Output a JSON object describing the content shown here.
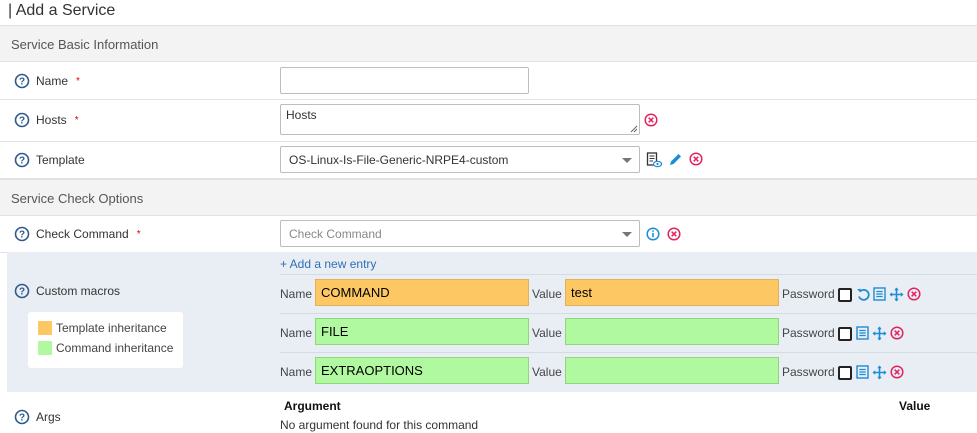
{
  "page": {
    "title": "| Add a Service"
  },
  "sections": {
    "basic": "Service Basic Information",
    "check": "Service Check Options"
  },
  "fields": {
    "name": {
      "label": "Name",
      "required": "*",
      "value": ""
    },
    "hosts": {
      "label": "Hosts",
      "required": "*",
      "value": "Hosts"
    },
    "template": {
      "label": "Template",
      "value": "OS-Linux-Is-File-Generic-NRPE4-custom"
    },
    "check_command": {
      "label": "Check Command",
      "required": "*",
      "placeholder": "Check Command"
    },
    "custom_macros": {
      "label": "Custom macros"
    },
    "args": {
      "label": "Args"
    }
  },
  "macros": {
    "add_entry": "+ Add a new entry",
    "name_label": "Name",
    "value_label": "Value",
    "password_label": "Password",
    "rows": [
      {
        "name": "COMMAND",
        "value": "test",
        "inheritance": "template"
      },
      {
        "name": "FILE",
        "value": "",
        "inheritance": "command"
      },
      {
        "name": "EXTRAOPTIONS",
        "value": "",
        "inheritance": "command"
      }
    ]
  },
  "legend": {
    "template": "Template inheritance",
    "command": "Command inheritance"
  },
  "args": {
    "col_argument": "Argument",
    "col_value": "Value",
    "empty": "No argument found for this command"
  },
  "colors": {
    "template_inheritance": "#fdc764",
    "command_inheritance": "#b1f9a0",
    "delete_icon": "#e0245e",
    "action_icon": "#1c8cd6"
  },
  "icons": {
    "help": "question-circle-icon",
    "remove": "close-circle-icon",
    "info": "info-circle-icon",
    "edit": "pencil-icon",
    "view": "document-eye-icon",
    "undo": "undo-icon",
    "details": "list-icon",
    "move": "move-icon"
  }
}
